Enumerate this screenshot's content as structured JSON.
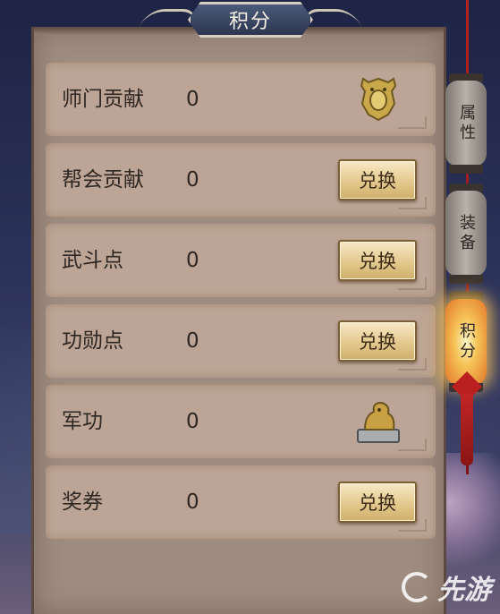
{
  "title": "积分",
  "rows": [
    {
      "label": "师门贡献",
      "value": "0",
      "action": null,
      "icon": "bronze-token-icon"
    },
    {
      "label": "帮会贡献",
      "value": "0",
      "action": "兑换",
      "icon": null
    },
    {
      "label": "武斗点",
      "value": "0",
      "action": "兑换",
      "icon": null
    },
    {
      "label": "功勋点",
      "value": "0",
      "action": "兑换",
      "icon": null
    },
    {
      "label": "军功",
      "value": "0",
      "action": null,
      "icon": "jade-seal-icon"
    },
    {
      "label": "奖券",
      "value": "0",
      "action": "兑换",
      "icon": null
    }
  ],
  "side_tabs": [
    {
      "label": "属性",
      "active": false
    },
    {
      "label": "装备",
      "active": false
    },
    {
      "label": "积分",
      "active": true
    }
  ],
  "watermark": {
    "logo": "先游-logo",
    "text": "先游"
  },
  "colors": {
    "panel": "#9e8c80",
    "row": "#bca596",
    "button": "#e4c98e",
    "title_plate": "#2c3650",
    "active_tab": "#f5c255"
  }
}
